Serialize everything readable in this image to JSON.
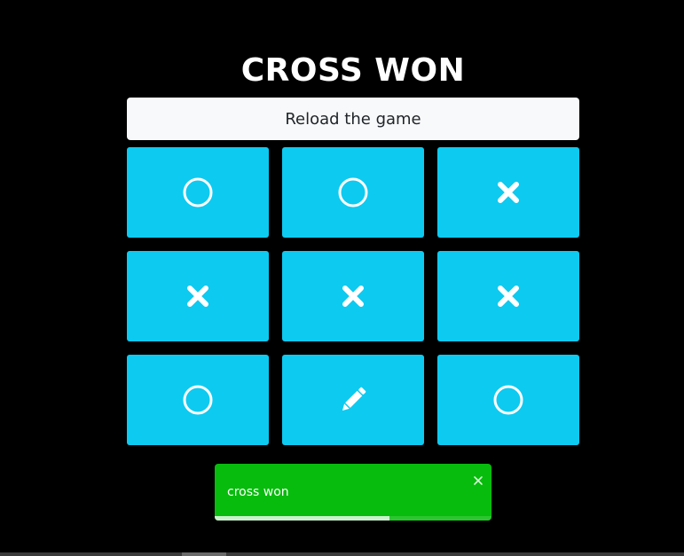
{
  "header": {
    "title": "CROSS WON"
  },
  "controls": {
    "reload_label": "Reload the game"
  },
  "board": {
    "cells": [
      "circle",
      "circle",
      "cross",
      "cross",
      "cross",
      "cross",
      "circle",
      "pencil",
      "circle"
    ],
    "cell_color": "#0dcaf0",
    "mark_color": "#ffffff"
  },
  "toast": {
    "message": "cross won",
    "close_icon": "close-icon",
    "color": "#07bc0c",
    "progress": 0.63
  }
}
